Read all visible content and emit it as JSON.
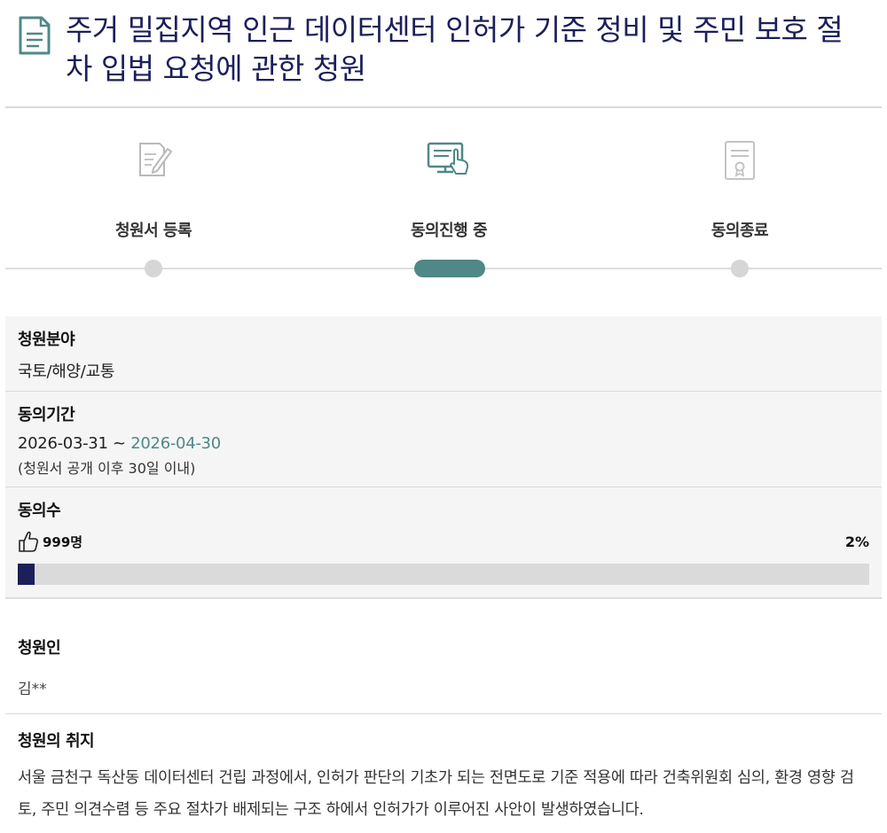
{
  "title": "주거 밀집지역 인근 데이터센터 인허가 기준 정비 및 주민 보호 절차 입법 요청에 관한 청원",
  "steps": [
    {
      "label": "청원서 등록",
      "icon": "document-edit-icon",
      "state": "done"
    },
    {
      "label": "동의진행 중",
      "icon": "monitor-touch-icon",
      "state": "current"
    },
    {
      "label": "동의종료",
      "icon": "certificate-icon",
      "state": "pending"
    }
  ],
  "field": {
    "label": "청원분야",
    "value": "국토/해양/교통"
  },
  "period": {
    "label": "동의기간",
    "start": "2026-03-31",
    "separator": " ~ ",
    "end": "2026-04-30",
    "note": "(청원서 공개 이후 30일 이내)"
  },
  "consent": {
    "label": "동의수",
    "count": "999명",
    "percent_text": "2%",
    "progress_percent": 2
  },
  "petitioner": {
    "label": "청원인",
    "name": "김**"
  },
  "purpose": {
    "label": "청원의 취지",
    "text": "서울 금천구 독산동 데이터센터 건립 과정에서, 인허가 판단의 기초가 되는 전면도로 기준 적용에 따라 건축위원회 심의, 환경 영향 검토, 주민 의견수렴 등 주요 절차가 배제되는 구조 하에서 인허가가 이루어진 사안이 발생하였습니다."
  },
  "colors": {
    "title": "#1c1f5a",
    "accent": "#4f8886",
    "progress": "#1c1f5a",
    "track": "#dadada"
  }
}
